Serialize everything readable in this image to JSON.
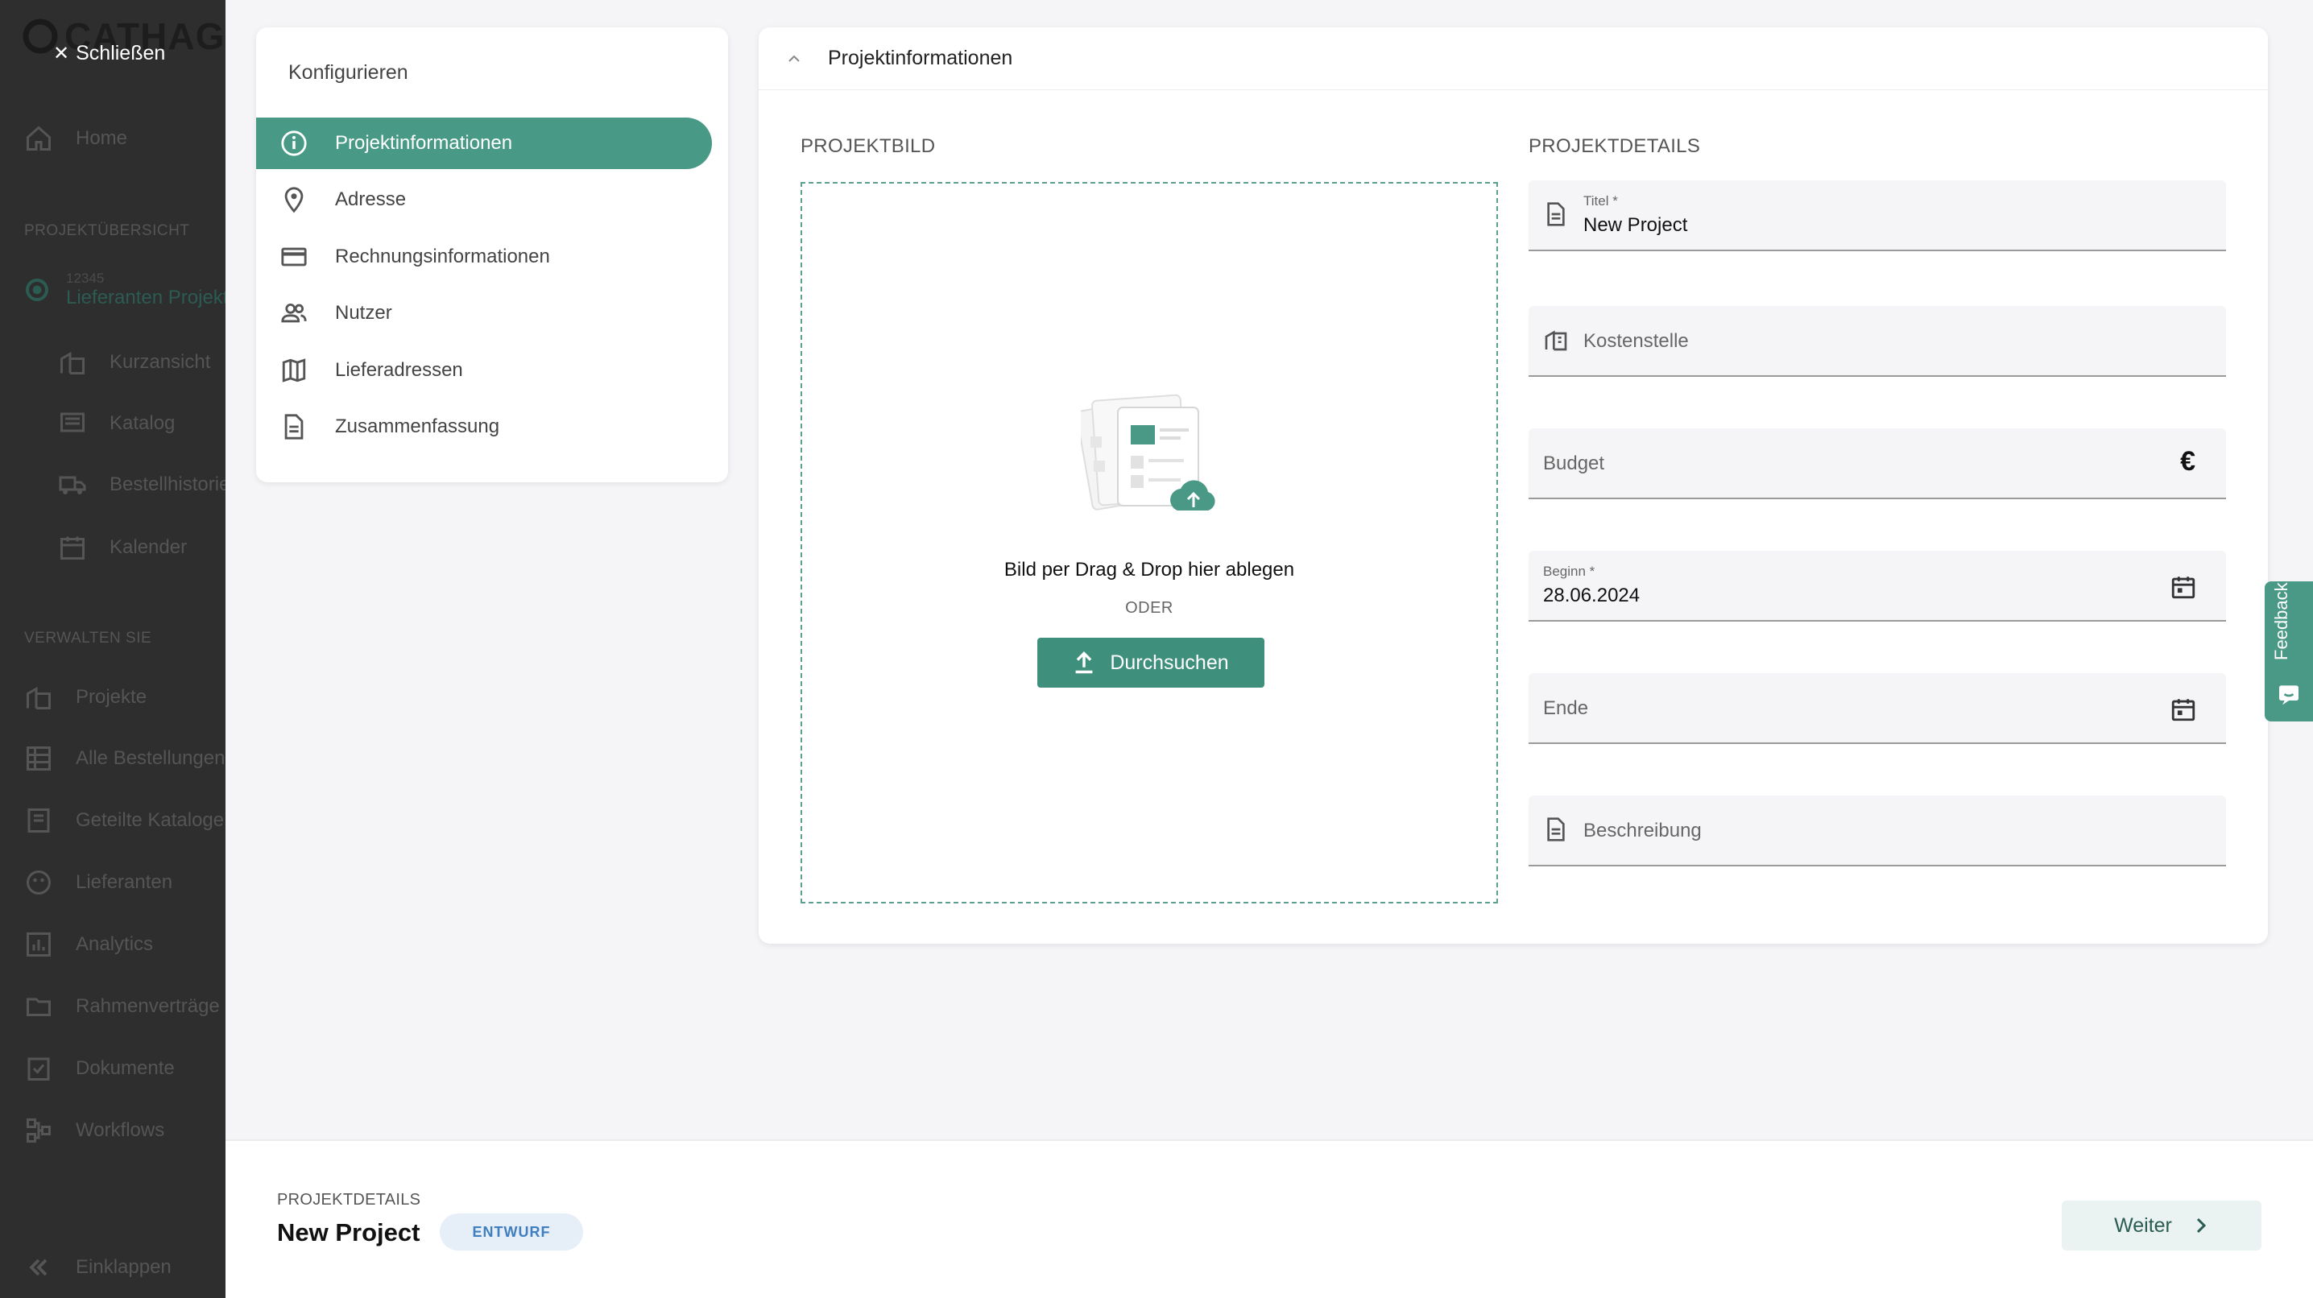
{
  "sidebar": {
    "logo_text": "CATHAG",
    "close_label": "Schließen",
    "home_label": "Home",
    "section_projects": "PROJEKTÜBERSICHT",
    "project_number": "12345",
    "project_name": "Lieferanten Projekt",
    "project_items": [
      "Kurzansicht",
      "Katalog",
      "Bestellhistorie",
      "Kalender"
    ],
    "section_manage": "VERWALTEN SIE",
    "manage_items": [
      "Projekte",
      "Alle Bestellungen",
      "Geteilte Kataloge",
      "Lieferanten",
      "Analytics",
      "Rahmenverträge",
      "Dokumente",
      "Workflows"
    ],
    "collapse_label": "Einklappen"
  },
  "config": {
    "title": "Konfigurieren",
    "steps": [
      {
        "label": "Projektinformationen",
        "icon": "info-icon",
        "active": true
      },
      {
        "label": "Adresse",
        "icon": "location-pin-icon",
        "active": false
      },
      {
        "label": "Rechnungsinformationen",
        "icon": "credit-card-icon",
        "active": false
      },
      {
        "label": "Nutzer",
        "icon": "users-icon",
        "active": false
      },
      {
        "label": "Lieferadressen",
        "icon": "map-icon",
        "active": false
      },
      {
        "label": "Zusammenfassung",
        "icon": "document-icon",
        "active": false
      }
    ]
  },
  "panel": {
    "header_title": "Projektinformationen",
    "image_section": "PROJEKTBILD",
    "details_section": "PROJEKTDETAILS",
    "dropzone_text": "Bild per Drag & Drop hier ablegen",
    "oder": "ODER",
    "browse_label": "Durchsuchen",
    "fields": {
      "titel_label": "Titel *",
      "titel_value": "New Project",
      "kostenstelle_placeholder": "Kostenstelle",
      "budget_placeholder": "Budget",
      "budget_currency": "€",
      "beginn_label": "Beginn *",
      "beginn_value": "28.06.2024",
      "ende_placeholder": "Ende",
      "beschreibung_placeholder": "Beschreibung"
    }
  },
  "feedback_label": "Feedback",
  "bottom": {
    "crumb": "PROJEKTDETAILS",
    "title": "New Project",
    "badge": "ENTWURF",
    "next_label": "Weiter"
  },
  "colors": {
    "accent": "#489a86",
    "sidebar_bg": "#2e2e2e",
    "badge_bg": "#e6eef8",
    "badge_text": "#3f7fbf"
  }
}
